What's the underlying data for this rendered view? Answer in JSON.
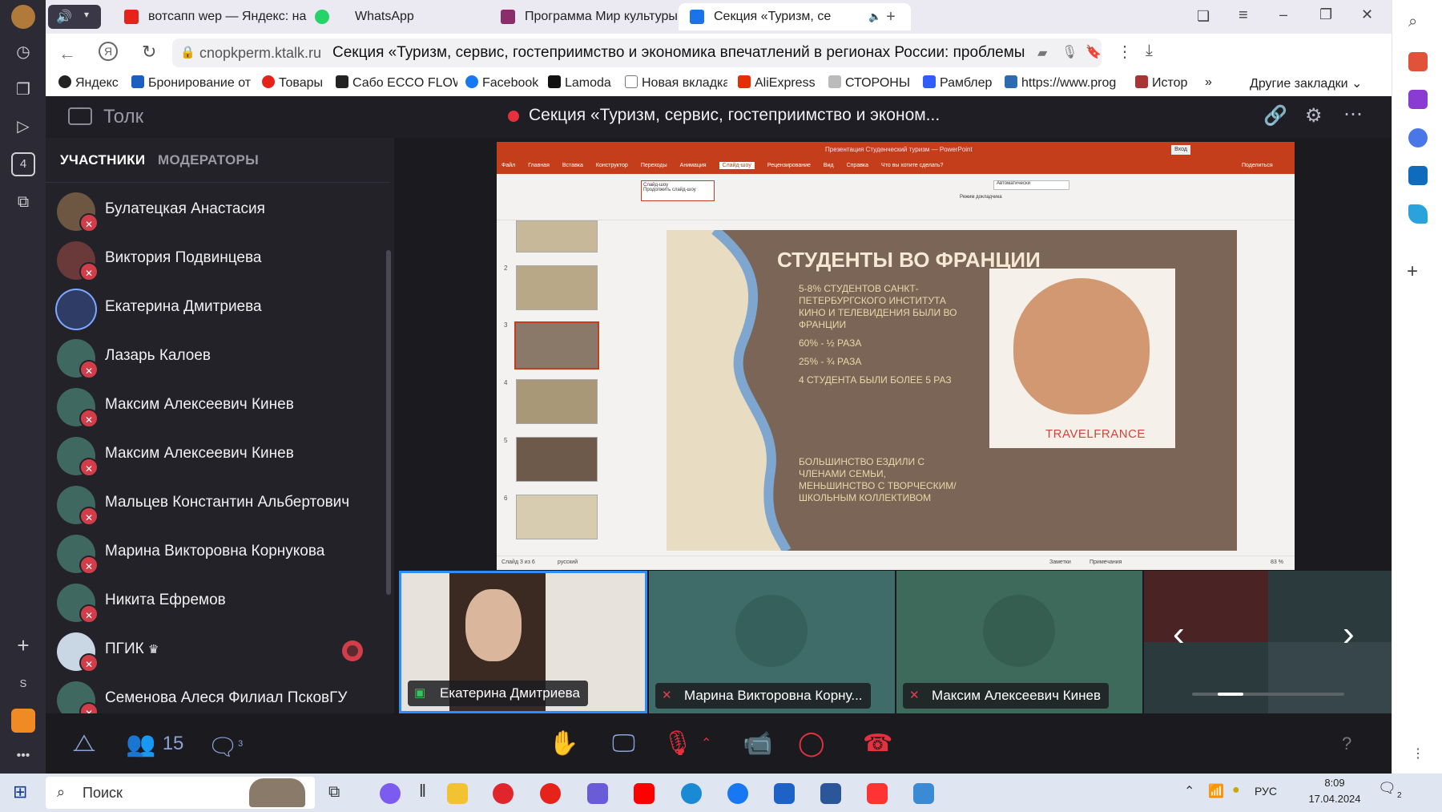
{
  "browser": {
    "tabs": [
      {
        "label": "вотсапп wep — Яндекс: на",
        "icon": "yandex-icon",
        "color": "#e5231b"
      },
      {
        "label": "WhatsApp",
        "icon": "whatsapp-icon",
        "color": "#25d366"
      },
      {
        "label": "Программа Мир культуры",
        "icon": "document-icon",
        "color": "#8b2d6b"
      },
      {
        "label": "Секция «Туризм, се",
        "icon": "video-icon",
        "color": "#1a73e8"
      }
    ],
    "address_domain": "cnopkperm.ktalk.ru",
    "page_title": "Секция «Туризм, сервис, гостеприимство и экономика впечатлений в регионах России: проблемы и перспек...",
    "bookmarks": [
      {
        "label": "Яндекс",
        "color": "#222222"
      },
      {
        "label": "Бронирование от",
        "color": "#1d5fbf"
      },
      {
        "label": "Товары",
        "color": "#e5231b"
      },
      {
        "label": "Сабо ECCO FLOW",
        "color": "#222222"
      },
      {
        "label": "Facebook",
        "color": "#1877f2"
      },
      {
        "label": "Lamoda",
        "color": "#111111"
      },
      {
        "label": "Новая вкладка",
        "color": "#777777"
      },
      {
        "label": "AliExpress",
        "color": "#e62e04"
      },
      {
        "label": "СТОРОНЫ",
        "color": "#888888"
      },
      {
        "label": "Рамблер",
        "color": "#315efb"
      },
      {
        "label": "https://www.prog",
        "color": "#2b6cb0"
      },
      {
        "label": "Истор",
        "color": "#a33"
      }
    ],
    "bookmarks_more": "»",
    "other_bookmarks": "Другие закладки"
  },
  "app": {
    "logo": "Толк",
    "meeting_title": "Секция «Туризм, сервис, гостеприимство и эконом...",
    "recording_color": "#e5303d"
  },
  "sidebar": {
    "tabs": [
      "УЧАСТНИКИ",
      "МОДЕРАТОРЫ"
    ],
    "participants": [
      {
        "name": "Булатецкая Анастасия",
        "avatar_color": "#6e5742"
      },
      {
        "name": "Виктория Подвинцева",
        "avatar_color": "#6a3a3a"
      },
      {
        "name": "Екатерина Дмитриева",
        "avatar_color": "#2e3c66",
        "active": true
      },
      {
        "name": "Лазарь Калоев",
        "avatar_color": "#3f6860"
      },
      {
        "name": "Максим Алексеевич Кинев",
        "avatar_color": "#3f6860"
      },
      {
        "name": "Максим Алексеевич Кинев",
        "avatar_color": "#3f6860"
      },
      {
        "name": "Мальцев Константин Альбертович",
        "avatar_color": "#3f6860"
      },
      {
        "name": "Марина Викторовна Корнукова",
        "avatar_color": "#3f6860"
      },
      {
        "name": "Никита Ефремов",
        "avatar_color": "#3f6860"
      },
      {
        "name": "ПГИК",
        "avatar_color": "#c9d6e4",
        "crown": "♛"
      },
      {
        "name": "Семенова Алеся Филиал ПсковГУ",
        "avatar_color": "#3f6860"
      }
    ]
  },
  "slide": {
    "window_title": "Презентация Студенческий туризм — PowerPoint",
    "ribbon_tabs": [
      "Файл",
      "Главная",
      "Вставка",
      "Конструктор",
      "Переходы",
      "Анимация",
      "Слайд-шоу",
      "Рецензирование",
      "Вид",
      "Справка",
      "Что вы хотите сделать?"
    ],
    "share_label": "Поделиться",
    "login_label": "Вход",
    "monitor_value": "Автоматически",
    "presenter_mode": "Режим докладчика",
    "slideshow_dropdown": "Слайд-шоу",
    "continue_label": "Продолжить слайд-шоу",
    "title": "СТУДЕНТЫ ВО ФРАНЦИИ",
    "bullets": [
      "5-8% СТУДЕНТОВ САНКТ-ПЕТЕРБУРГСКОГО ИНСТИТУТА КИНО И ТЕЛЕВИДЕНИЯ БЫЛИ ВО ФРАНЦИИ",
      "60% - ½ РАЗА",
      "25% - ¾ РАЗА",
      "4 СТУДЕНТА БЫЛИ БОЛЕЕ 5 РАЗ"
    ],
    "bullet_bottom": "БОЛЬШИНСТВО ЕЗДИЛИ С ЧЛЕНАМИ СЕМЬИ, МЕНЬШИНСТВО С ТВОРЧЕСКИМ/ ШКОЛЬНЫМ КОЛЛЕКТИВОМ",
    "image_caption": "TRAVELFRANCE",
    "thumbnail_numbers": [
      "2",
      "3",
      "4",
      "5",
      "6"
    ],
    "status_left": "Слайд 3 из 6",
    "status_lang": "русский",
    "status_notes": "Заметки",
    "status_comments": "Примечания",
    "zoom": "83 %"
  },
  "tiles": [
    {
      "name": "Екатерина Дмитриева",
      "state": "sharing"
    },
    {
      "name": "Марина Викторовна Корну...",
      "state": "muted"
    },
    {
      "name": "Максим Алексеевич Кинев",
      "state": "muted"
    }
  ],
  "toolbar": {
    "participants_count": "15",
    "chat_badge": "3"
  },
  "taskbar": {
    "search_placeholder": "Поиск",
    "lang": "РУС",
    "time": "8:09",
    "date": "17.04.2024",
    "notification_count": "2"
  }
}
